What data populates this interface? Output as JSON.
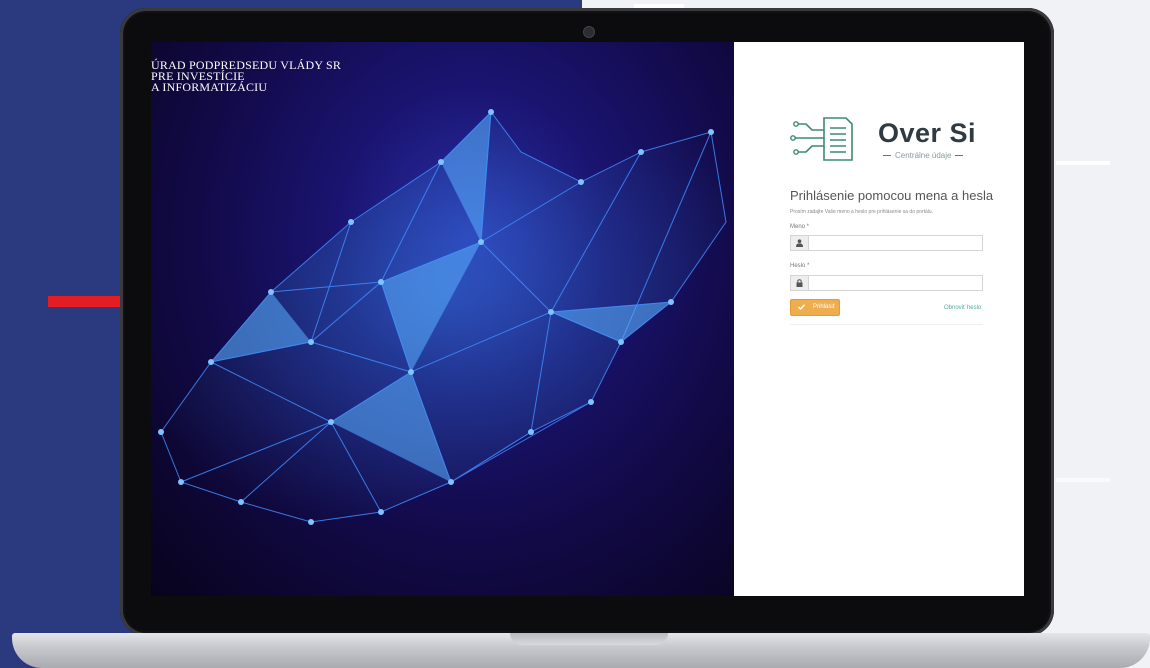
{
  "screen": {
    "organization": {
      "line1": "ÚRAD PODPREDSEDU VLÁDY SR",
      "line2": "PRE INVESTÍCIE",
      "line3": "A INFORMATIZÁCIU"
    },
    "logo": {
      "title": "Over Si",
      "subtitle": "Centrálne údaje"
    },
    "login": {
      "title": "Prihlásenie pomocou mena a hesla",
      "hint": "Prosím zadajte Vaše meno a heslo pre prihlásenie sa do portálu.",
      "username_label": "Meno *",
      "username_value": "",
      "username_placeholder": "",
      "password_label": "Heslo *",
      "password_value": "",
      "password_placeholder": "",
      "submit_label": "Prihlásiť",
      "reset_link": "Obnoviť heslo"
    }
  },
  "colors": {
    "background_left": "#2b3a7e",
    "accent_red": "#e41c23",
    "button_orange": "#f0ad4e",
    "link_green": "#4cae9a",
    "logo_green": "#3d8a73"
  },
  "icons": [
    "user-icon",
    "lock-icon",
    "check-icon",
    "document-circuit-logo-icon"
  ]
}
